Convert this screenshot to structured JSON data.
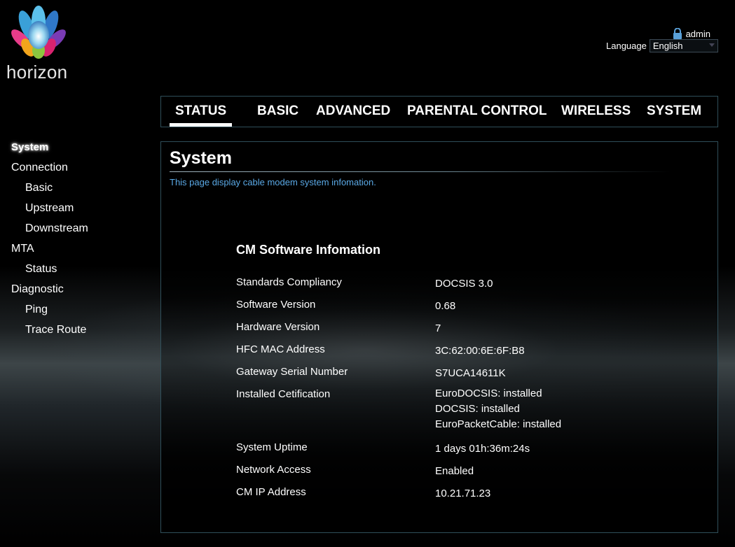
{
  "brand": {
    "logo_text": "horizon"
  },
  "header": {
    "user": "admin",
    "language_label": "Language",
    "language_value": "English"
  },
  "nav": {
    "items": [
      "STATUS",
      "BASIC",
      "ADVANCED",
      "PARENTAL CONTROL",
      "WIRELESS",
      "SYSTEM"
    ],
    "active": "STATUS"
  },
  "sidebar": {
    "items": [
      {
        "label": "System",
        "level": 0,
        "active": true
      },
      {
        "label": "Connection",
        "level": 0
      },
      {
        "label": "Basic",
        "level": 1
      },
      {
        "label": "Upstream",
        "level": 1
      },
      {
        "label": "Downstream",
        "level": 1
      },
      {
        "label": "MTA",
        "level": 0
      },
      {
        "label": "Status",
        "level": 1
      },
      {
        "label": "Diagnostic",
        "level": 0
      },
      {
        "label": "Ping",
        "level": 1
      },
      {
        "label": "Trace Route",
        "level": 1
      }
    ]
  },
  "main": {
    "title": "System",
    "description": "This page display cable modem system infomation.",
    "section_title": "CM Software Infomation",
    "rows": [
      {
        "label": "Standards Compliancy",
        "value": "DOCSIS 3.0"
      },
      {
        "label": "Software Version",
        "value": "0.68"
      },
      {
        "label": "Hardware Version",
        "value": "7"
      },
      {
        "label": "HFC MAC Address",
        "value": "3C:62:00:6E:6F:B8"
      },
      {
        "label": "Gateway Serial Number",
        "value": "S7UCA14611K"
      },
      {
        "label": "Installed Cetification",
        "value": "EuroDOCSIS: installed",
        "value2": "DOCSIS: installed",
        "value3": "EuroPacketCable: installed"
      },
      {
        "label": "System Uptime",
        "value": "1 days 01h:36m:24s"
      },
      {
        "label": "Network Access",
        "value": "Enabled"
      },
      {
        "label": "CM IP Address",
        "value": "10.21.71.23"
      }
    ]
  },
  "colors": {
    "accent_link": "#5aa9e6",
    "border": "#2f4f5a"
  }
}
